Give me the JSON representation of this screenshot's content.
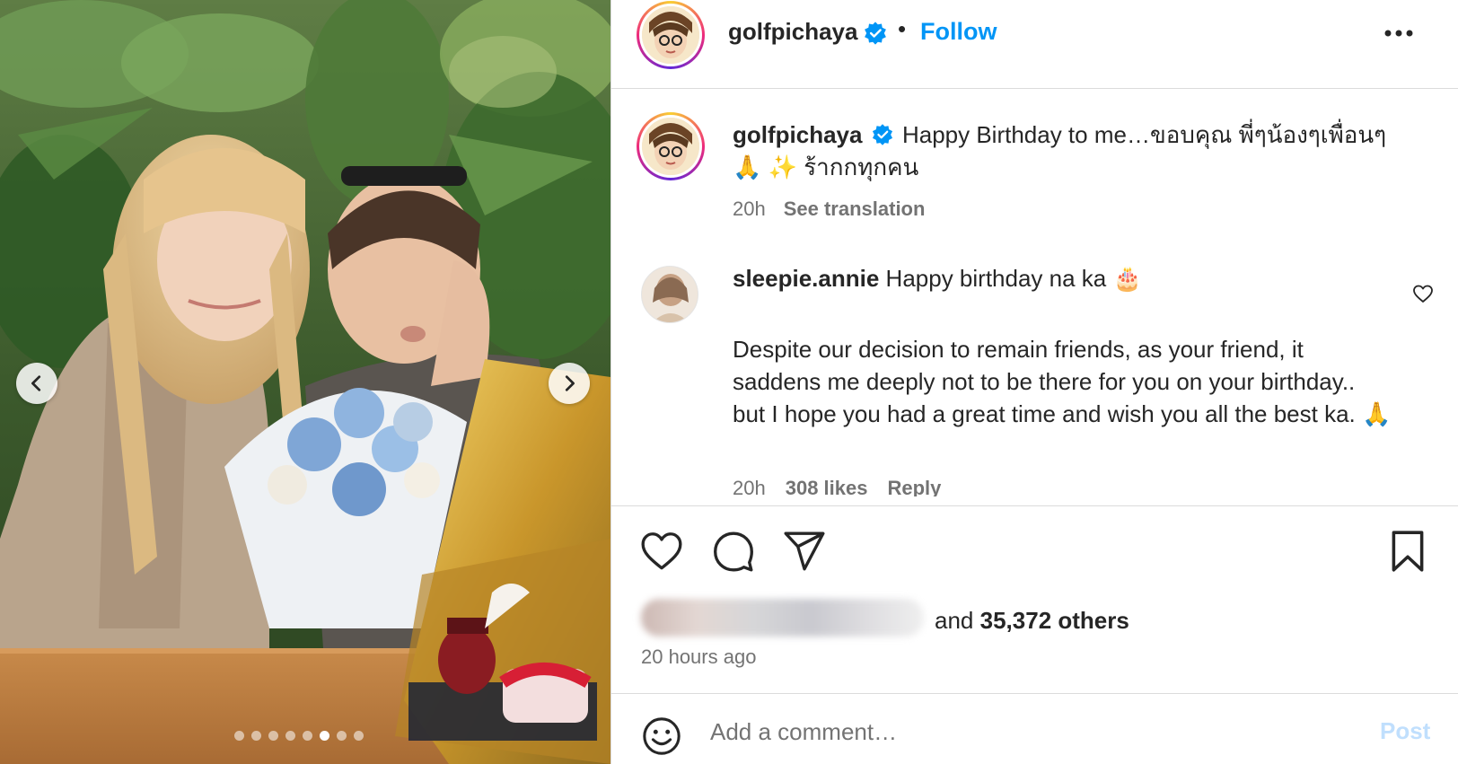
{
  "post": {
    "username": "golfpichaya",
    "separator": "•",
    "follow_label": "Follow",
    "more_label": "More options"
  },
  "caption": {
    "username": "golfpichaya",
    "text_line1": "Happy Birthday to me…ขอบคุณ พี่ๆน้องๆเพื่อนๆ",
    "text_line2": "🙏 ✨ ร้ากกทุกคน",
    "time": "20h",
    "see_translation": "See translation"
  },
  "comment": {
    "username": "sleepie.annie",
    "headline": "Happy birthday na ka 🎂",
    "body": "Despite our decision to remain friends, as your friend, it saddens me deeply not to be there for you on your birthday.. but I hope you had a great time and wish you all the best ka. 🙏",
    "time": "20h",
    "likes": "308 likes",
    "reply": "Reply"
  },
  "engagement": {
    "likes_prefix": "and",
    "likes_count": "35,372 others",
    "time_ago": "20 hours ago"
  },
  "composer": {
    "placeholder": "Add a comment…",
    "post_label": "Post"
  },
  "carousel": {
    "total_slides": 8,
    "active_slide": 6
  },
  "colors": {
    "accent": "#0095f6",
    "text": "#262626",
    "muted": "#737373",
    "post_disabled": "#c0dffd",
    "border": "#dbdbdb"
  },
  "icons": {
    "verified": "verified-badge-icon",
    "more": "more-horizontal-icon",
    "like": "heart-icon",
    "comment": "comment-bubble-icon",
    "share": "paper-plane-icon",
    "save": "bookmark-icon",
    "emoji": "smiley-icon",
    "prev": "chevron-left-icon",
    "next": "chevron-right-icon"
  }
}
